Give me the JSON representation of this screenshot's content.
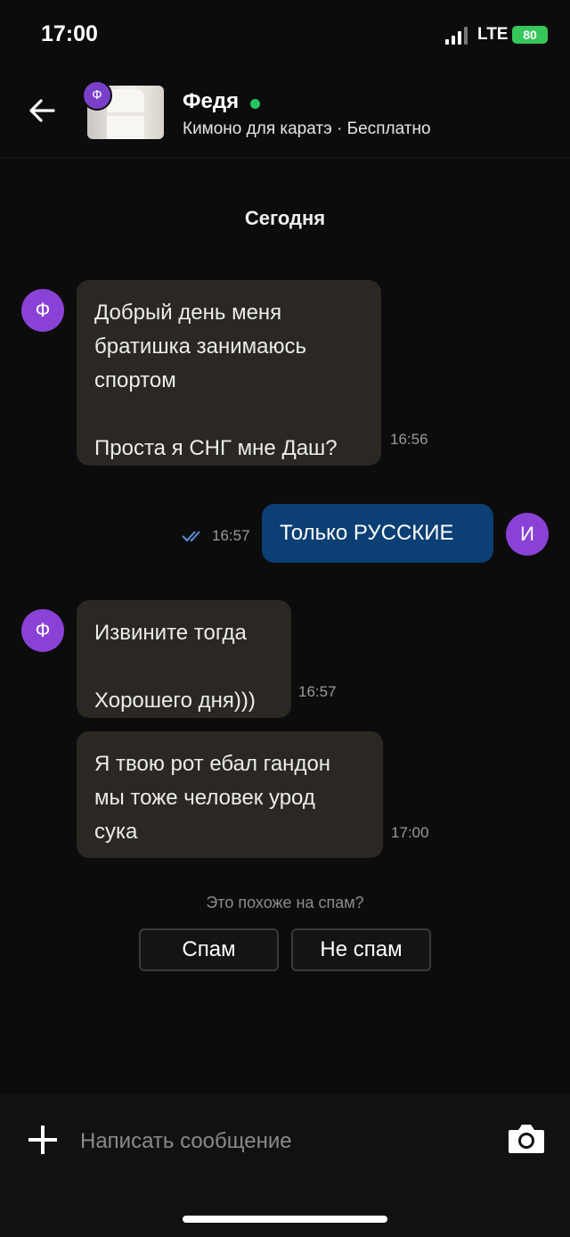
{
  "status_bar": {
    "time": "17:00",
    "network": "LTE",
    "battery": "80"
  },
  "header": {
    "back_icon": "arrow-left-icon",
    "avatar_letter": "Ф",
    "contact_name": "Федя",
    "subtitle": "Кимоно для каратэ · Бесплатно",
    "online_color": "#22c55e"
  },
  "date_divider": "Сегодня",
  "messages": [
    {
      "direction": "in",
      "avatar": "Ф",
      "text": "Добрый день меня\nбратишка занимаюсь\nспортом\n\nПроста я СНГ мне Даш?",
      "time": "16:56"
    },
    {
      "direction": "out",
      "avatar": "И",
      "text": "Только РУССКИЕ",
      "time": "16:57",
      "read": true
    },
    {
      "direction": "in",
      "avatar": "Ф",
      "text": "Извините тогда\n\nХорошего дня)))",
      "time": "16:57"
    },
    {
      "direction": "in",
      "text": "Я твою рот ебал гандон\nмы тоже человек урод\nсука",
      "time": "17:00"
    }
  ],
  "spam_prompt": {
    "question": "Это похоже на спам?",
    "spam_label": "Спам",
    "not_spam_label": "Не спам"
  },
  "composer": {
    "placeholder": "Написать сообщение",
    "attach_icon": "plus-icon",
    "camera_icon": "camera-icon"
  },
  "colors": {
    "avatar_purple": "#8a42d6",
    "incoming_bubble": "#2b2824",
    "outgoing_bubble": "#0c3f73",
    "battery_green": "#35c759"
  }
}
